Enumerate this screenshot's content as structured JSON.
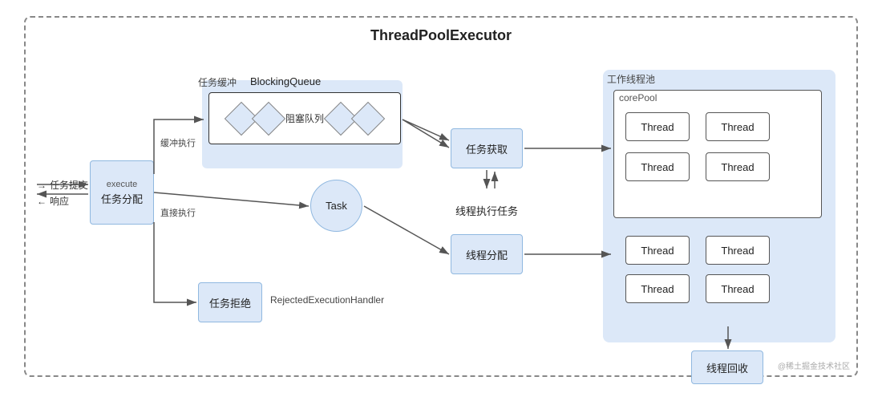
{
  "title": "ThreadPoolExecutor",
  "labels": {
    "work_pool": "工作线程池",
    "core_pool": "corePool",
    "task_dispatch": "任务分配",
    "execute": "execute",
    "task_fetch": "任务获取",
    "thread_exec": "线程执行任务",
    "task_circle": "Task",
    "thread_dispatch": "线程分配",
    "task_reject": "任务拒绝",
    "rejected_handler": "RejectedExecutionHandler",
    "thread_recycle": "线程回收",
    "blocking_queue_area": "任务缓冲",
    "blocking_queue": "BlockingQueue",
    "queue_text": "阻塞队列",
    "buffer_exec": "缓冲执行",
    "direct_exec": "直接执行",
    "task_submit": "任务提交",
    "response": "响应",
    "thread": "Thread",
    "watermark": "@稀土掘金技术社区"
  }
}
